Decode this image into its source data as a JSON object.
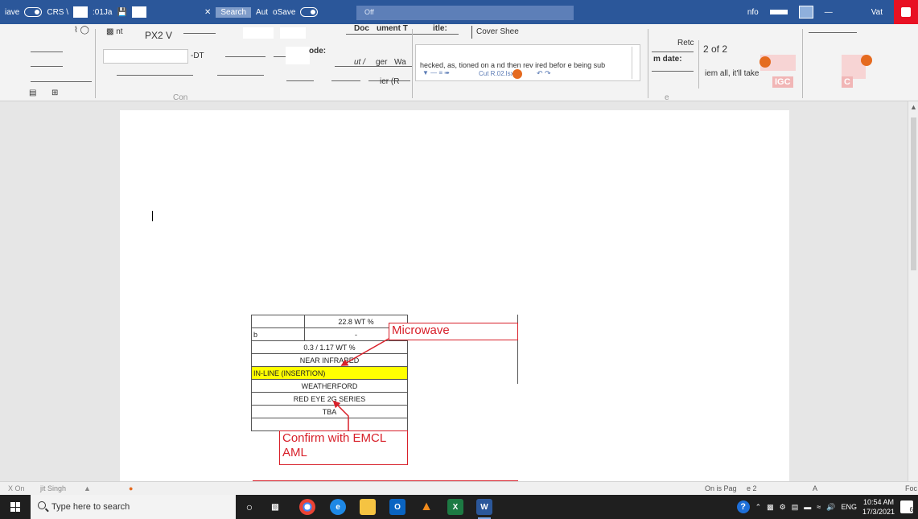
{
  "titlebar": {
    "autosave_label": "iave",
    "file_prefix": "CRS \\",
    "file_sub": ":01Ja",
    "search_label": "Search",
    "search_after": "Aut",
    "autosave2_label": "oSave",
    "title_box": "Off",
    "right_label": "nfo",
    "user_label": "Vat",
    "colors": {
      "bar": "#2b579a",
      "close": "#e81123"
    }
  },
  "ribbon": {
    "font_name": "PX2 V",
    "tag_doc": "Doc",
    "tag_ument": "ument T",
    "tag_itle": "itle:",
    "cover_sheet": "Cover Shee",
    "code_label": "ode:",
    "field_dt": "-DT",
    "cut_label": "ut /",
    "ger_label": "ger",
    "wa_label": "Wa",
    "ier_label": "ier (R",
    "comment_text": "hecked, as, tioned on a  nd then rev ired befor  e being sub",
    "cut_file": "Cut R.02.lsx",
    "ret_label": "Retc",
    "m_date": "m date:",
    "page_of": "2 of 2",
    "them_all": "iem all, it'll take",
    "tag_igc": "IGC",
    "tag_c": "C",
    "group_con": "Con",
    "group_e": "e"
  },
  "document": {
    "table_rows": [
      {
        "left": "",
        "right": "22.8 WT %"
      },
      {
        "left": "b",
        "right": "-"
      }
    ],
    "rows": [
      "0.3 / 1.17 WT %",
      "NEAR INFRARED",
      "IN-LINE (INSERTION)",
      "WEATHERFORD",
      "RED EYE 2G SERIES",
      "TBA",
      ""
    ],
    "callout_1": "Microwave",
    "callout_2_line1": "Confirm with EMCL",
    "callout_2_line2": "AML",
    "colors": {
      "highlight": "#ffff00",
      "callout": "#d8202a"
    }
  },
  "statusbar": {
    "left_text": "X On",
    "author": "jit Singh",
    "page_info": "On is Pag",
    "page_num": "e 2",
    "focus": "Foc"
  },
  "taskbar": {
    "search_placeholder": "Type here to search",
    "lang": "ENG",
    "time": "10:54 AM",
    "date": "17/3/2021",
    "notif_count": "6",
    "apps": [
      "cortana-icon",
      "task-view-icon",
      "chrome-icon",
      "edge-icon",
      "file-explorer-icon",
      "outlook-icon",
      "vlc-icon",
      "excel-icon",
      "word-icon"
    ]
  }
}
